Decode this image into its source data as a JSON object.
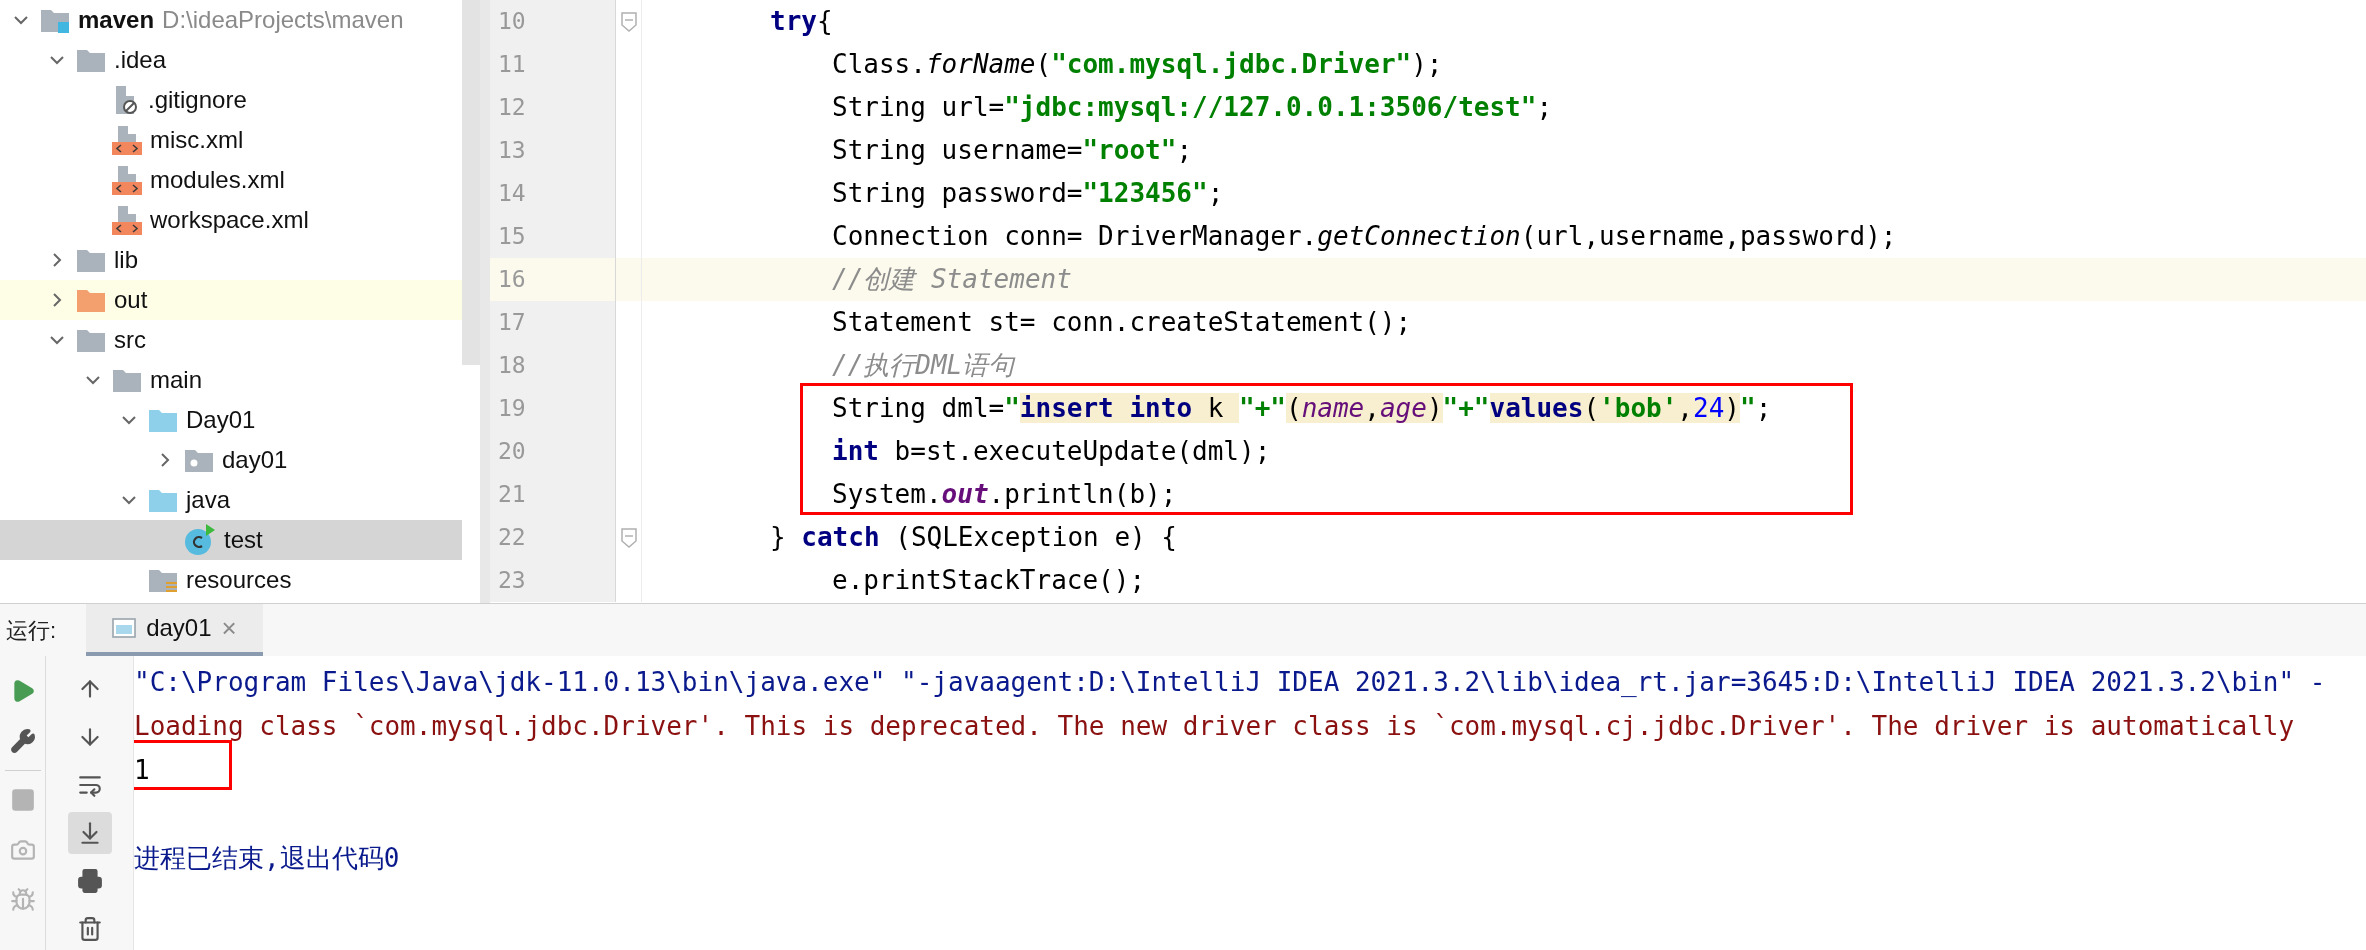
{
  "project_tree": {
    "items": [
      {
        "label": "maven",
        "path": "D:\\ideaProjects\\maven",
        "kind": "project",
        "expanded": true,
        "selected": false,
        "children": [
          {
            "label": ".idea",
            "kind": "folder",
            "expanded": true,
            "selected": false,
            "children": [
              {
                "label": ".gitignore",
                "kind": "ignored-file",
                "selected": false
              },
              {
                "label": "misc.xml",
                "kind": "xml-file",
                "selected": false
              },
              {
                "label": "modules.xml",
                "kind": "xml-file",
                "selected": false
              },
              {
                "label": "workspace.xml",
                "kind": "xml-file",
                "selected": false
              }
            ]
          },
          {
            "label": "lib",
            "kind": "folder",
            "expanded": false,
            "selected": false
          },
          {
            "label": "out",
            "kind": "excluded-folder",
            "expanded": false,
            "selected": false,
            "highlighted": true
          },
          {
            "label": "src",
            "kind": "folder",
            "expanded": true,
            "selected": false,
            "children": [
              {
                "label": "main",
                "kind": "folder",
                "expanded": true,
                "selected": false,
                "children": [
                  {
                    "label": "Day01",
                    "kind": "source-folder",
                    "expanded": true,
                    "selected": false,
                    "children": [
                      {
                        "label": "day01",
                        "kind": "package",
                        "expanded": false,
                        "selected": false
                      }
                    ]
                  },
                  {
                    "label": "java",
                    "kind": "source-folder",
                    "expanded": true,
                    "selected": false,
                    "children": [
                      {
                        "label": "test",
                        "kind": "class",
                        "selected": true
                      }
                    ]
                  },
                  {
                    "label": "resources",
                    "kind": "resources-folder",
                    "selected": false
                  }
                ]
              }
            ]
          }
        ]
      }
    ]
  },
  "editor": {
    "lines": [
      {
        "number": "10",
        "current": false,
        "fold": true,
        "nested": false,
        "tokens": [
          {
            "kind": "keyword",
            "text": "try"
          },
          {
            "kind": "plain",
            "text": "{"
          }
        ]
      },
      {
        "number": "11",
        "current": false,
        "fold": false,
        "nested": true,
        "tokens": [
          {
            "kind": "plain",
            "text": "Class."
          },
          {
            "kind": "static-method",
            "text": "forName"
          },
          {
            "kind": "plain",
            "text": "("
          },
          {
            "kind": "string",
            "text": "\"com.mysql.jdbc.Driver\""
          },
          {
            "kind": "plain",
            "text": ");"
          }
        ]
      },
      {
        "number": "12",
        "current": false,
        "fold": false,
        "nested": true,
        "tokens": [
          {
            "kind": "plain",
            "text": "String url="
          },
          {
            "kind": "string",
            "text": "\"jdbc:mysql://127.0.0.1:3506/test\""
          },
          {
            "kind": "plain",
            "text": ";"
          }
        ]
      },
      {
        "number": "13",
        "current": false,
        "fold": false,
        "nested": true,
        "tokens": [
          {
            "kind": "plain",
            "text": "String username="
          },
          {
            "kind": "string",
            "text": "\"root\""
          },
          {
            "kind": "plain",
            "text": ";"
          }
        ]
      },
      {
        "number": "14",
        "current": false,
        "fold": false,
        "nested": true,
        "tokens": [
          {
            "kind": "plain",
            "text": "String password="
          },
          {
            "kind": "string",
            "text": "\"123456\""
          },
          {
            "kind": "plain",
            "text": ";"
          }
        ]
      },
      {
        "number": "15",
        "current": false,
        "fold": false,
        "nested": true,
        "tokens": [
          {
            "kind": "plain",
            "text": "Connection conn= DriverManager."
          },
          {
            "kind": "static-method",
            "text": "getConnection"
          },
          {
            "kind": "plain",
            "text": "(url,username,password);"
          }
        ]
      },
      {
        "number": "16",
        "current": true,
        "fold": false,
        "nested": true,
        "tokens": [
          {
            "kind": "comment",
            "text": "//创建 Statement"
          }
        ]
      },
      {
        "number": "17",
        "current": false,
        "fold": false,
        "nested": true,
        "tokens": [
          {
            "kind": "plain",
            "text": "Statement st= conn.createStatement();"
          }
        ]
      },
      {
        "number": "18",
        "current": false,
        "fold": false,
        "nested": true,
        "tokens": [
          {
            "kind": "comment",
            "text": "//执行DML语句"
          }
        ]
      },
      {
        "number": "19",
        "current": false,
        "fold": false,
        "nested": true,
        "tokens": [
          {
            "kind": "plain",
            "text": "String dml="
          },
          {
            "kind": "string",
            "text": "\""
          },
          {
            "kind": "keyword",
            "text": "insert into",
            "injected": true
          },
          {
            "kind": "plain",
            "text": " k ",
            "injected": true
          },
          {
            "kind": "string",
            "text": "\"+\""
          },
          {
            "kind": "plain",
            "text": "(",
            "injected": true
          },
          {
            "kind": "field",
            "text": "name",
            "injected": true
          },
          {
            "kind": "plain",
            "text": ",",
            "injected": true
          },
          {
            "kind": "field",
            "text": "age",
            "injected": true
          },
          {
            "kind": "plain",
            "text": ")",
            "injected": true
          },
          {
            "kind": "string",
            "text": "\"+\""
          },
          {
            "kind": "keyword",
            "text": "values",
            "injected": true
          },
          {
            "kind": "plain",
            "text": "(",
            "injected": true
          },
          {
            "kind": "string",
            "text": "'bob'",
            "injected": true
          },
          {
            "kind": "plain",
            "text": ",",
            "injected": true
          },
          {
            "kind": "number",
            "text": "24",
            "injected": true
          },
          {
            "kind": "plain",
            "text": ")",
            "injected": true
          },
          {
            "kind": "string",
            "text": "\""
          },
          {
            "kind": "plain",
            "text": ";"
          }
        ]
      },
      {
        "number": "20",
        "current": false,
        "fold": false,
        "nested": true,
        "tokens": [
          {
            "kind": "keyword",
            "text": "int"
          },
          {
            "kind": "plain",
            "text": " b=st.executeUpdate(dml);"
          }
        ]
      },
      {
        "number": "21",
        "current": false,
        "fold": false,
        "nested": true,
        "tokens": [
          {
            "kind": "plain",
            "text": "System."
          },
          {
            "kind": "static-field",
            "text": "out"
          },
          {
            "kind": "plain",
            "text": ".println(b);"
          }
        ]
      },
      {
        "number": "22",
        "current": false,
        "fold": true,
        "nested": false,
        "tokens": [
          {
            "kind": "plain",
            "text": "} "
          },
          {
            "kind": "keyword",
            "text": "catch"
          },
          {
            "kind": "plain",
            "text": " (SQLException e) {"
          }
        ]
      },
      {
        "number": "23",
        "current": false,
        "fold": false,
        "nested": true,
        "tokens": [
          {
            "kind": "plain",
            "text": "e.printStackTrace();"
          }
        ]
      }
    ]
  },
  "run_panel": {
    "label": "运行:",
    "tabs": [
      {
        "label": "day01",
        "close": "×",
        "selected": true
      }
    ],
    "left_tools": [
      {
        "kind": "rerun",
        "disabled": false
      },
      {
        "kind": "settings",
        "disabled": false
      },
      {
        "kind": "stop",
        "disabled": true
      },
      {
        "kind": "snapshot",
        "disabled": true
      },
      {
        "kind": "debug",
        "disabled": true
      }
    ],
    "right_tools": [
      {
        "kind": "up",
        "on": false
      },
      {
        "kind": "down",
        "on": false
      },
      {
        "kind": "wrap",
        "on": false
      },
      {
        "kind": "scroll-end",
        "on": true
      },
      {
        "kind": "print",
        "on": false
      },
      {
        "kind": "clear",
        "on": false
      }
    ],
    "console": [
      {
        "kind": "command",
        "text": "\"C:\\Program Files\\Java\\jdk-11.0.13\\bin\\java.exe\" \"-javaagent:D:\\IntelliJ IDEA 2021.3.2\\lib\\idea_rt.jar=3645:D:\\IntelliJ IDEA 2021.3.2\\bin\" -"
      },
      {
        "kind": "error",
        "text": "Loading class `com.mysql.jdbc.Driver'. This is deprecated. The new driver class is `com.mysql.cj.jdbc.Driver'. The driver is automatically"
      },
      {
        "kind": "output",
        "text": "1"
      },
      {
        "kind": "blank"
      },
      {
        "kind": "system",
        "text": "进程已结束,退出代码0"
      }
    ]
  }
}
